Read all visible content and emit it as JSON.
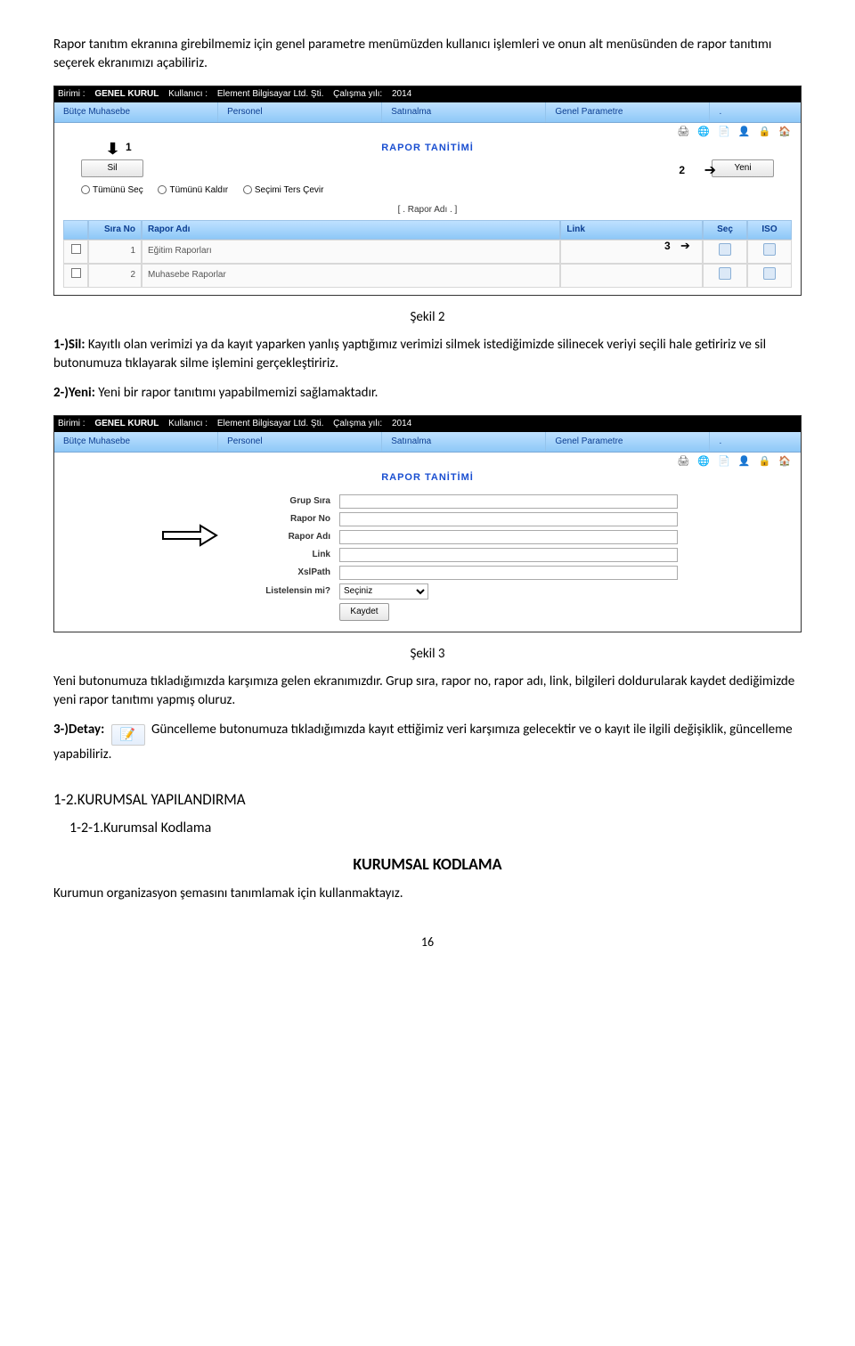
{
  "intro": "Rapor tanıtım ekranına girebilmemiz için genel parametre menümüzden kullanıcı işlemleri ve onun alt menüsünden de rapor tanıtımı seçerek ekranımızı açabiliriz.",
  "fig2": {
    "topbar": {
      "birimi_lbl": "Birimi :",
      "birimi": "GENEL KURUL",
      "kullanici_lbl": "Kullanıcı :",
      "kullanici": "Element Bilgisayar Ltd. Şti.",
      "yil_lbl": "Çalışma yılı:",
      "yil": "2014"
    },
    "menubar": [
      "Bütçe Muhasebe",
      "Personel",
      "Satınalma",
      "Genel Parametre",
      "."
    ],
    "title": "RAPOR TANİTİMİ",
    "btn_sil": "Sil",
    "btn_yeni": "Yeni",
    "radios": [
      "Tümünü Seç",
      "Tümünü Kaldır",
      "Seçimi Ters Çevir"
    ],
    "list_hdr": "[ . Rapor Adı . ]",
    "table": {
      "headers": [
        "",
        "Sıra No",
        "Rapor Adı",
        "Link",
        "Seç",
        "ISO"
      ],
      "rows": [
        {
          "sira": "1",
          "ad": "Eğitim Raporları",
          "link": ""
        },
        {
          "sira": "2",
          "ad": "Muhasebe Raporlar",
          "link": ""
        }
      ]
    },
    "markers": {
      "m1": "1",
      "m2": "2",
      "m3": "3"
    },
    "caption": "Şekil 2"
  },
  "p_sil_lbl": "1-)Sil:",
  "p_sil": "  Kayıtlı olan verimizi ya da kayıt yaparken yanlış yaptığımız verimizi silmek istediğimizde silinecek veriyi seçili hale getiririz ve sil butonumuza tıklayarak silme işlemini gerçekleştiririz.",
  "p_yeni_lbl": "2-)Yeni:",
  "p_yeni": "  Yeni bir rapor tanıtımı yapabilmemizi sağlamaktadır.",
  "fig3": {
    "topbar": {
      "birimi_lbl": "Birimi :",
      "birimi": "GENEL KURUL",
      "kullanici_lbl": "Kullanıcı :",
      "kullanici": "Element Bilgisayar Ltd. Şti.",
      "yil_lbl": "Çalışma yılı:",
      "yil": "2014"
    },
    "menubar": [
      "Bütçe Muhasebe",
      "Personel",
      "Satınalma",
      "Genel Parametre",
      "."
    ],
    "title": "RAPOR TANİTİMİ",
    "form": {
      "l_grup": "Grup Sıra",
      "l_rno": "Rapor No",
      "l_radi": "Rapor Adı",
      "l_link": "Link",
      "l_xsl": "XslPath",
      "l_list": "Listelensin mi?",
      "sel_opt": "Seçiniz",
      "btn_kaydet": "Kaydet"
    },
    "caption": "Şekil 3"
  },
  "p_fig3": "Yeni butonumuza tıkladığımızda karşımıza gelen ekranımızdır. Grup sıra, rapor no, rapor adı, link, bilgileri doldurularak kaydet dediğimizde yeni rapor tanıtımı yapmış oluruz.",
  "p_detay_lbl": "3-)Detay:",
  "p_detay": " Güncelleme butonumuza tıkladığımızda kayıt ettiğimiz veri karşımıza gelecektir ve o kayıt ile ilgili değişiklik, güncelleme yapabiliriz.",
  "h_12": "1-2.KURUMSAL YAPILANDIRMA",
  "h_121": "1-2-1.Kurumsal Kodlama",
  "h_big": "KURUMSAL KODLAMA",
  "p_last": "Kurumun organizasyon şemasını tanımlamak için kullanmaktayız.",
  "pagenum": "16"
}
